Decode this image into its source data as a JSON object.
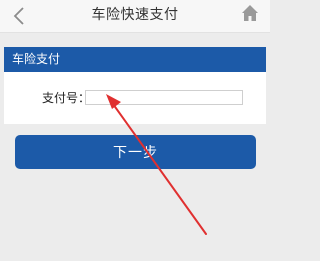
{
  "header": {
    "title": "车险快速支付",
    "back_icon": "chevron-left-icon",
    "home_icon": "home-icon"
  },
  "section": {
    "title": "车险支付"
  },
  "form": {
    "pay_label": "支付号：",
    "pay_value": "",
    "pay_placeholder": ""
  },
  "actions": {
    "next_label": "下一步"
  },
  "colors": {
    "primary": "#1c5aa8",
    "background": "#ececec",
    "annotation_arrow": "#e03030"
  }
}
